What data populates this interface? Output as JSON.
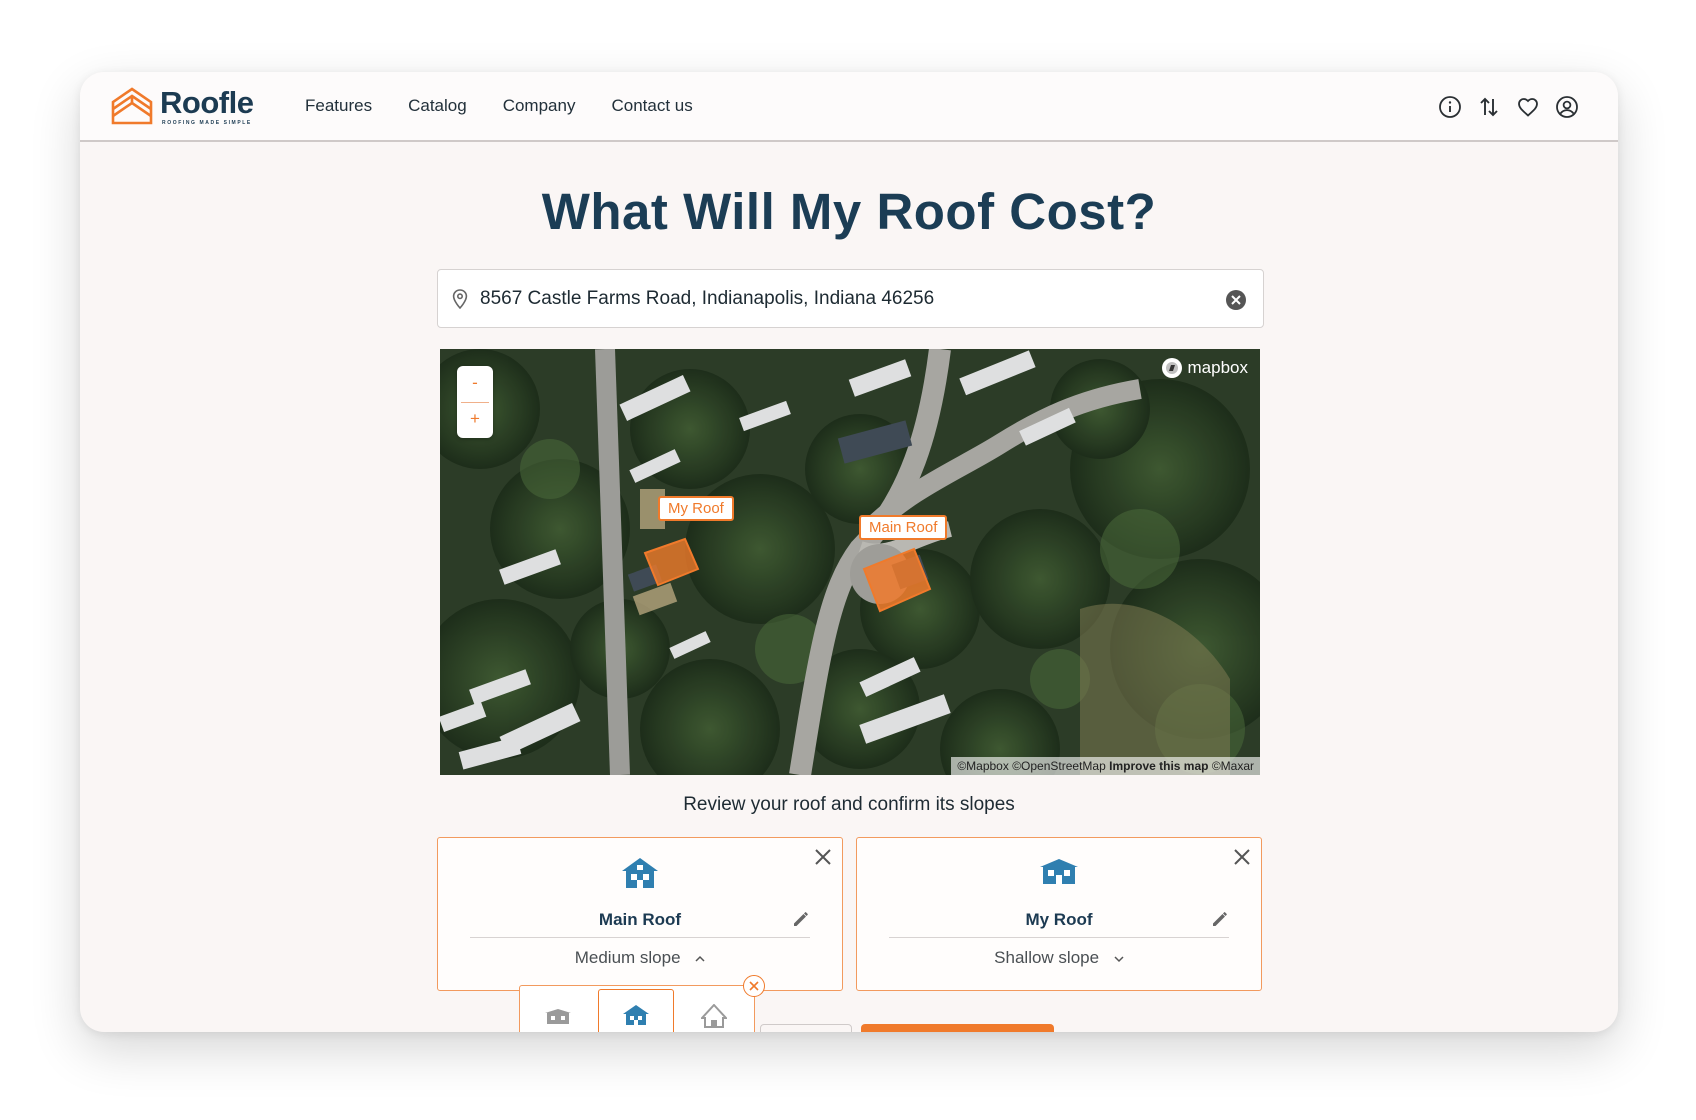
{
  "brand": {
    "name": "Roofle",
    "tagline": "ROOFING MADE SIMPLE",
    "accent_color": "#f07a2b",
    "primary_color": "#1c3b52"
  },
  "nav": {
    "links": [
      "Features",
      "Catalog",
      "Company",
      "Contact us"
    ],
    "icons": [
      "info-icon",
      "sort-arrows-icon",
      "heart-icon",
      "user-circle-icon"
    ]
  },
  "page": {
    "title": "What Will My Roof Cost?"
  },
  "search": {
    "value": "8567 Castle Farms Road, Indianapolis, Indiana 46256",
    "icon": "location-pin-icon",
    "clear_icon": "clear-circle-icon"
  },
  "map": {
    "zoom_out": "-",
    "zoom_in": "+",
    "mapbox_logo": "mapbox",
    "attribution": {
      "mapbox": "©Mapbox",
      "osm": "©OpenStreetMap",
      "improve": "Improve this map",
      "maxar": "©Maxar"
    },
    "roof_labels": [
      "My Roof",
      "Main Roof"
    ]
  },
  "review": {
    "text": "Review your roof and confirm its slopes"
  },
  "cards": [
    {
      "name": "Main Roof",
      "slope": "Medium slope",
      "expanded": true
    },
    {
      "name": "My Roof",
      "slope": "Shallow slope",
      "expanded": false
    }
  ],
  "slope_options": [
    "flat-house-icon",
    "medium-house-icon",
    "steep-house-icon"
  ],
  "selected_slope_index": 1
}
